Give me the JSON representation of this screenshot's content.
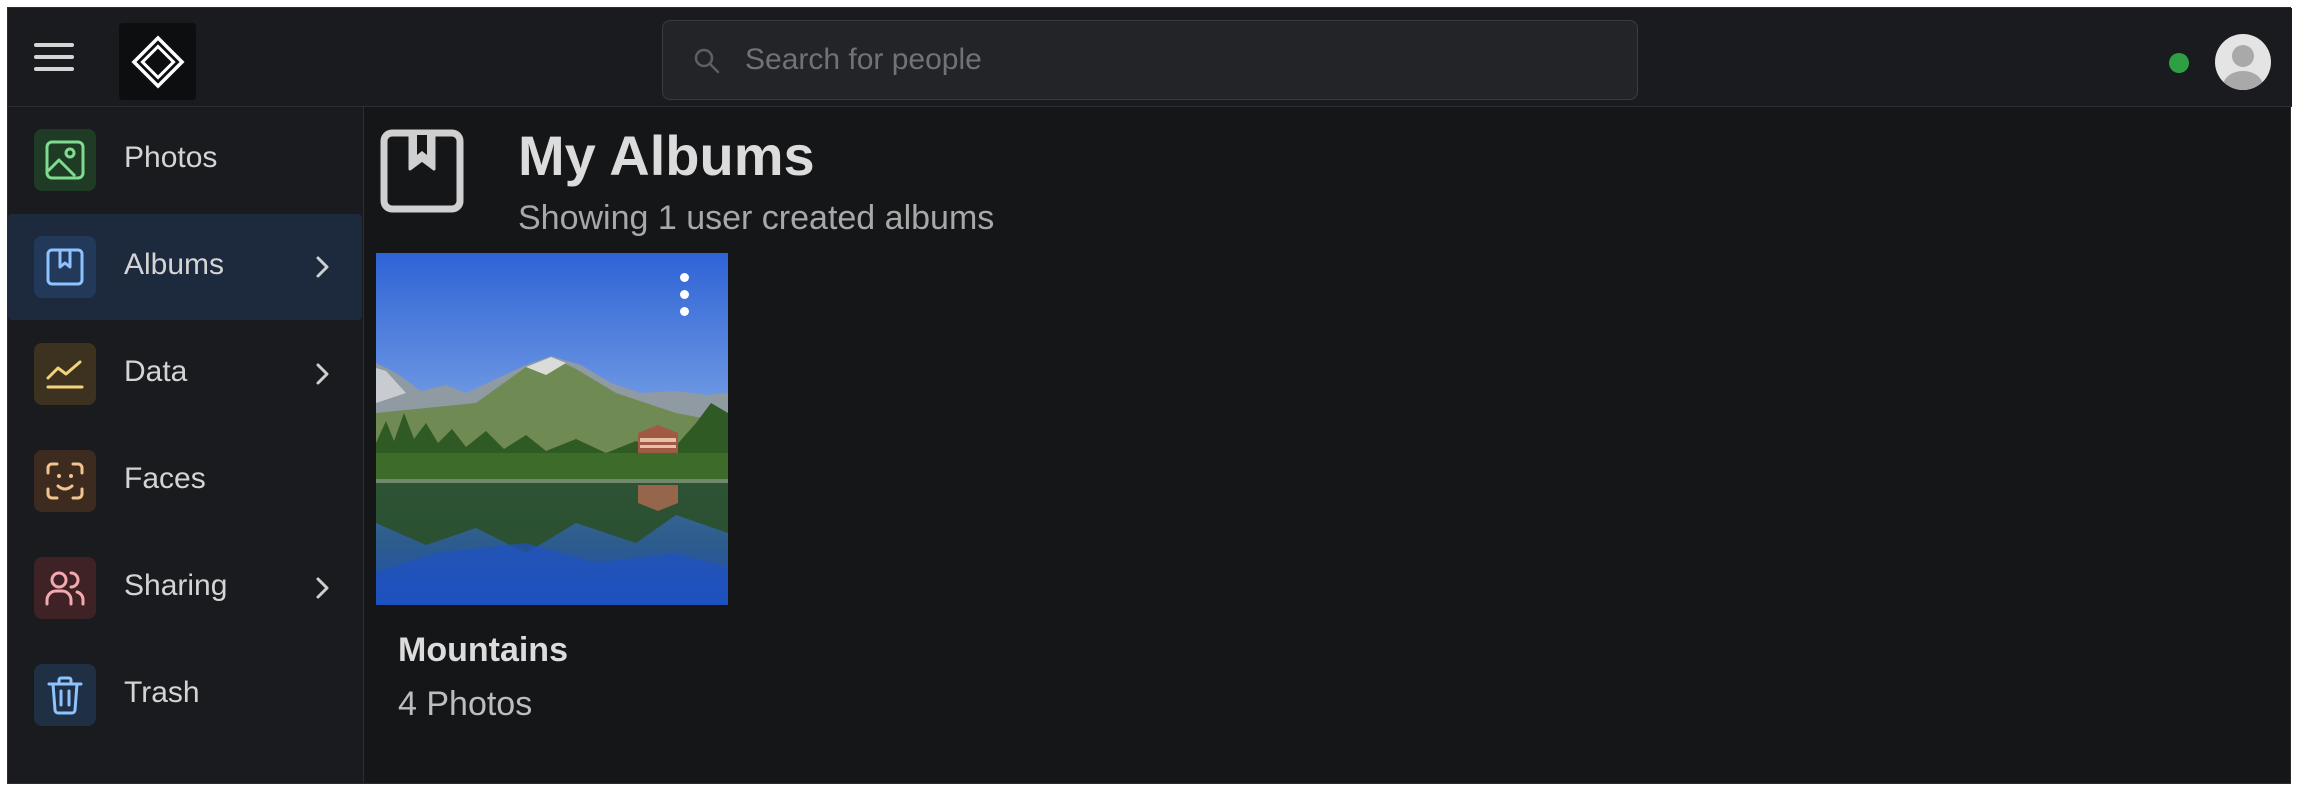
{
  "header": {
    "menu_icon": "hamburger-icon",
    "logo_icon": "diamond-logo-icon",
    "search": {
      "placeholder": "Search for people",
      "value": "",
      "icon": "search-icon"
    },
    "status_color": "#2ea043",
    "avatar_icon": "user-avatar-icon"
  },
  "sidebar": {
    "items": [
      {
        "label": "Photos",
        "icon": "photo-icon",
        "icon_bg": "#1f3a25",
        "icon_color": "#7fdc8f",
        "active": false,
        "has_chevron": false
      },
      {
        "label": "Albums",
        "icon": "album-icon",
        "icon_bg": "#22395a",
        "icon_color": "#8fc3ff",
        "active": true,
        "has_chevron": true
      },
      {
        "label": "Data",
        "icon": "chart-icon",
        "icon_bg": "#3d3220",
        "icon_color": "#f2d27a",
        "active": false,
        "has_chevron": true
      },
      {
        "label": "Faces",
        "icon": "face-scan-icon",
        "icon_bg": "#3d2b20",
        "icon_color": "#f2c38f",
        "active": false,
        "has_chevron": false
      },
      {
        "label": "Sharing",
        "icon": "users-icon",
        "icon_bg": "#3f2226",
        "icon_color": "#f4a9b0",
        "active": false,
        "has_chevron": true
      },
      {
        "label": "Trash",
        "icon": "trash-icon",
        "icon_bg": "#1f2f44",
        "icon_color": "#8fc3ff",
        "active": false,
        "has_chevron": false
      }
    ]
  },
  "main": {
    "title": "My Albums",
    "subtitle": "Showing 1 user created albums",
    "page_icon": "album-icon",
    "albums": [
      {
        "name": "Mountains",
        "count": "4 Photos",
        "thumbnail": "mountain-lake-thumbnail",
        "menu_icon": "kebab-menu-icon"
      }
    ]
  }
}
